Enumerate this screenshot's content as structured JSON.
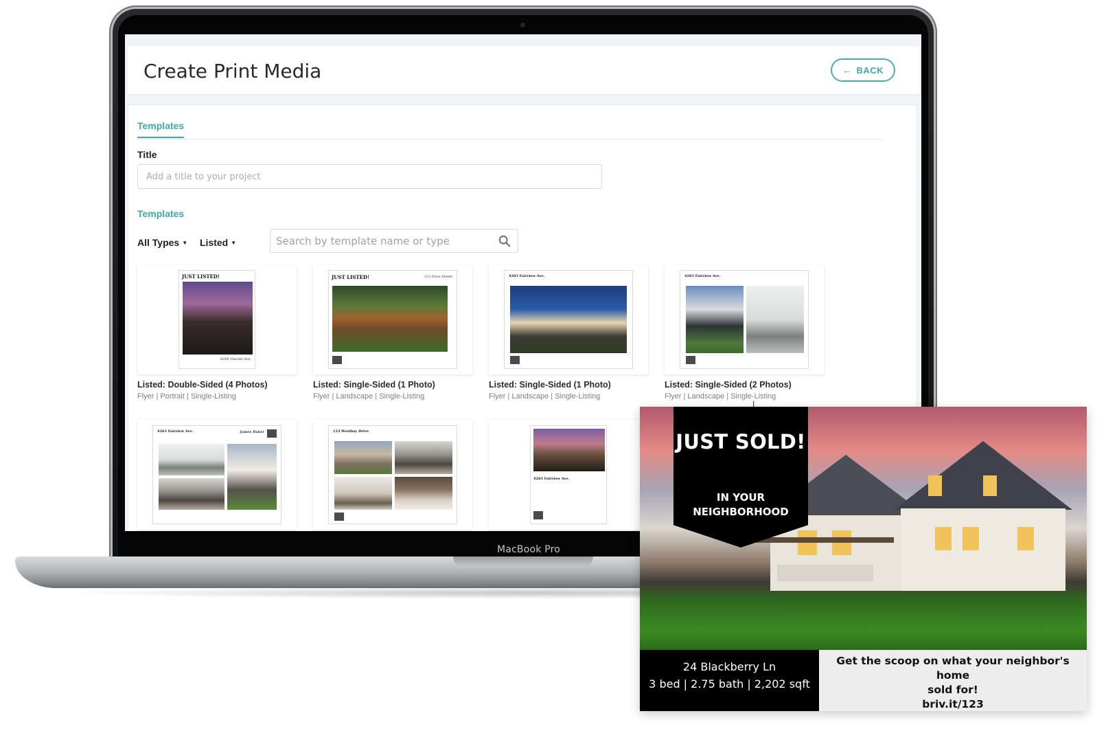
{
  "device": {
    "chin_label": "MacBook Pro"
  },
  "header": {
    "title": "Create Print Media",
    "back_label": "BACK"
  },
  "tabs": [
    {
      "label": "Templates",
      "active": true
    }
  ],
  "form": {
    "title_label": "Title",
    "title_placeholder": "Add a title to your project",
    "title_value": ""
  },
  "templates_section": {
    "label": "Templates",
    "filters": {
      "type": "All Types",
      "status": "Listed"
    },
    "search_placeholder": "Search by template name or type"
  },
  "cards": [
    {
      "name": "Listed: Double-Sided (4 Photos)",
      "meta": "Flyer | Portrait | Single-Listing",
      "heading": "JUST LISTED!",
      "footer": "8264 Glacier Ave."
    },
    {
      "name": "Listed: Single-Sided (1 Photo)",
      "meta": "Flyer | Landscape | Single-Listing",
      "heading": "JUST LISTED!",
      "footer": "123 Dove Street"
    },
    {
      "name": "Listed: Single-Sided (1 Photo)",
      "meta": "Flyer | Landscape | Single-Listing",
      "heading": "4263 Fairview Ave."
    },
    {
      "name": "Listed: Single-Sided (2 Photos)",
      "meta": "Flyer | Landscape | Single-Listing",
      "heading": "4263 Fairview Ave."
    },
    {
      "heading": "4263 Fairview Ave.",
      "agent": "James Baker"
    },
    {
      "heading": "123 Westbay Drive"
    },
    {
      "heading": "4263 Fairview Ave."
    }
  ],
  "postcard": {
    "headline": "JUST SOLD!",
    "sub_line1": "IN YOUR",
    "sub_line2": "NEIGHBORHOOD",
    "address": "24 Blackberry Ln",
    "details": "3 bed | 2.75 bath | 2,202 sqft",
    "cta_line1": "Get the scoop on what your neighbor's home",
    "cta_line2": "sold for!",
    "link": "briv.it/123"
  },
  "colors": {
    "accent": "#3fa8ab",
    "postcard_black": "#000000",
    "postcard_gray": "#ededed"
  }
}
